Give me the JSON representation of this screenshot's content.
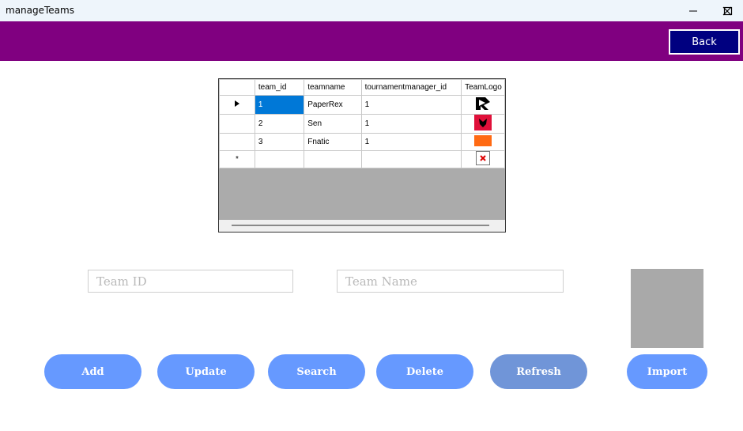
{
  "window": {
    "title": "manageTeams"
  },
  "header": {
    "back_label": "Back"
  },
  "grid": {
    "columns": [
      "team_id",
      "teamname",
      "tournamentmanager_id",
      "TeamLogo"
    ],
    "rows": [
      {
        "team_id": "1",
        "teamname": "PaperRex",
        "tournamentmanager_id": "1",
        "logo": "paperrex-logo"
      },
      {
        "team_id": "2",
        "teamname": "Sen",
        "tournamentmanager_id": "1",
        "logo": "sen-logo"
      },
      {
        "team_id": "3",
        "teamname": "Fnatic",
        "tournamentmanager_id": "1",
        "logo": "fnatic-logo"
      }
    ],
    "new_row_marker": "*"
  },
  "form": {
    "team_id_placeholder": "Team ID",
    "team_name_placeholder": "Team Name"
  },
  "buttons": {
    "add": "Add",
    "update": "Update",
    "search": "Search",
    "delete": "Delete",
    "refresh": "Refresh",
    "import": "Import"
  },
  "colors": {
    "header_bar": "#800080",
    "back_button": "#000080",
    "action_button": "#6699ff",
    "refresh_button": "#7095d8",
    "grid_background": "#ababab",
    "selection": "#0078d7"
  }
}
